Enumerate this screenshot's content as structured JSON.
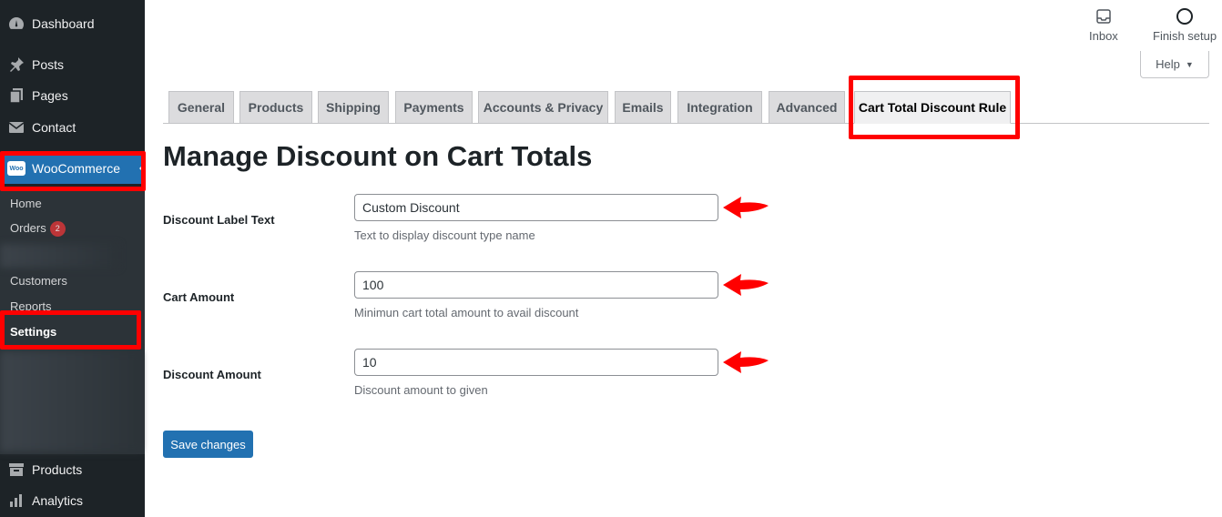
{
  "sidebar": {
    "menu": {
      "dashboard": "Dashboard",
      "posts": "Posts",
      "pages": "Pages",
      "contact": "Contact",
      "woocommerce": "WooCommerce",
      "products": "Products",
      "analytics": "Analytics"
    },
    "woo_logo_text": "Woo",
    "submenu": {
      "home": "Home",
      "orders": "Orders",
      "orders_badge": "2",
      "customers": "Customers",
      "reports": "Reports",
      "settings": "Settings"
    }
  },
  "activity": {
    "inbox": "Inbox",
    "finish_setup": "Finish setup"
  },
  "help": {
    "label": "Help",
    "arrow": "▼"
  },
  "tabs": [
    "General",
    "Products",
    "Shipping",
    "Payments",
    "Accounts & Privacy",
    "Emails",
    "Integration",
    "Advanced",
    "Cart Total Discount Rule"
  ],
  "active_tab": "Cart Total Discount Rule",
  "page_title": "Manage Discount on Cart Totals",
  "form": {
    "discount_label": {
      "label": "Discount Label Text",
      "value": "Custom Discount",
      "description": "Text to display discount type name"
    },
    "cart_amount": {
      "label": "Cart Amount",
      "value": "100",
      "description": "Minimun cart total amount to avail discount"
    },
    "discount_amount": {
      "label": "Discount Amount",
      "value": "10",
      "description": "Discount amount to given"
    }
  },
  "save_label": "Save changes",
  "colors": {
    "sidebar_bg": "#1d2327",
    "submenu_bg": "#2c3338",
    "accent": "#2271b1",
    "highlight": "#ff0000"
  }
}
